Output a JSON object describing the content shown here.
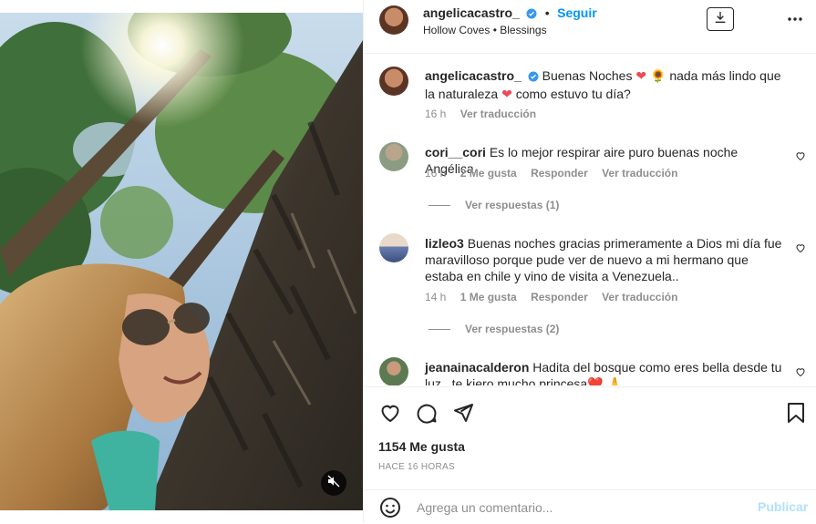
{
  "header": {
    "username": "angelicacastro_",
    "separator": "•",
    "follow_label": "Seguir",
    "audio": "Hollow Coves • Blessings"
  },
  "caption": {
    "username": "angelicacastro_",
    "text_1": "Buenas Noches",
    "text_2": "nada más lindo que la",
    "text_3": "naturaleza",
    "text_4": "como estuvo tu día?",
    "emoji_heart": "❤",
    "emoji_sunflower": "🌻",
    "age": "16 h",
    "translate": "Ver traducción"
  },
  "comments": [
    {
      "username": "cori__cori",
      "text": "Es lo mejor respirar aire puro buenas noche Angélica",
      "age": "16 h",
      "likes": "2 Me gusta",
      "reply": "Responder",
      "translate": "Ver traducción",
      "view_replies": "Ver respuestas (1)"
    },
    {
      "username": "lizleo3",
      "text": "Buenas noches gracias primeramente a Dios mi día fue maravilloso porque pude ver de nuevo a mi hermano que estaba en chile y vino de visita a Venezuela..",
      "age": "14 h",
      "likes": "1 Me gusta",
      "reply": "Responder",
      "translate": "Ver traducción",
      "view_replies": "Ver respuestas (2)"
    },
    {
      "username": "jeanainacalderon",
      "text": "Hadita del bosque como eres bella desde tu luz , te kiero mucho princesa❤️ 🙏"
    }
  ],
  "actions": {
    "likes": "1154 Me gusta",
    "time": "HACE 16 HORAS"
  },
  "add_comment": {
    "placeholder": "Agrega un comentario...",
    "publish": "Publicar"
  },
  "colors": {
    "accent": "#0095f6",
    "verified": "#3897f0",
    "heart": "#ed4956",
    "muted_text": "#8e8e8e",
    "publish_disabled": "#b2dffc"
  },
  "icons": [
    "verified-badge-icon",
    "download-icon",
    "more-options-icon",
    "heart-icon",
    "comment-icon",
    "share-icon",
    "save-icon",
    "emoji-icon",
    "mute-icon"
  ]
}
